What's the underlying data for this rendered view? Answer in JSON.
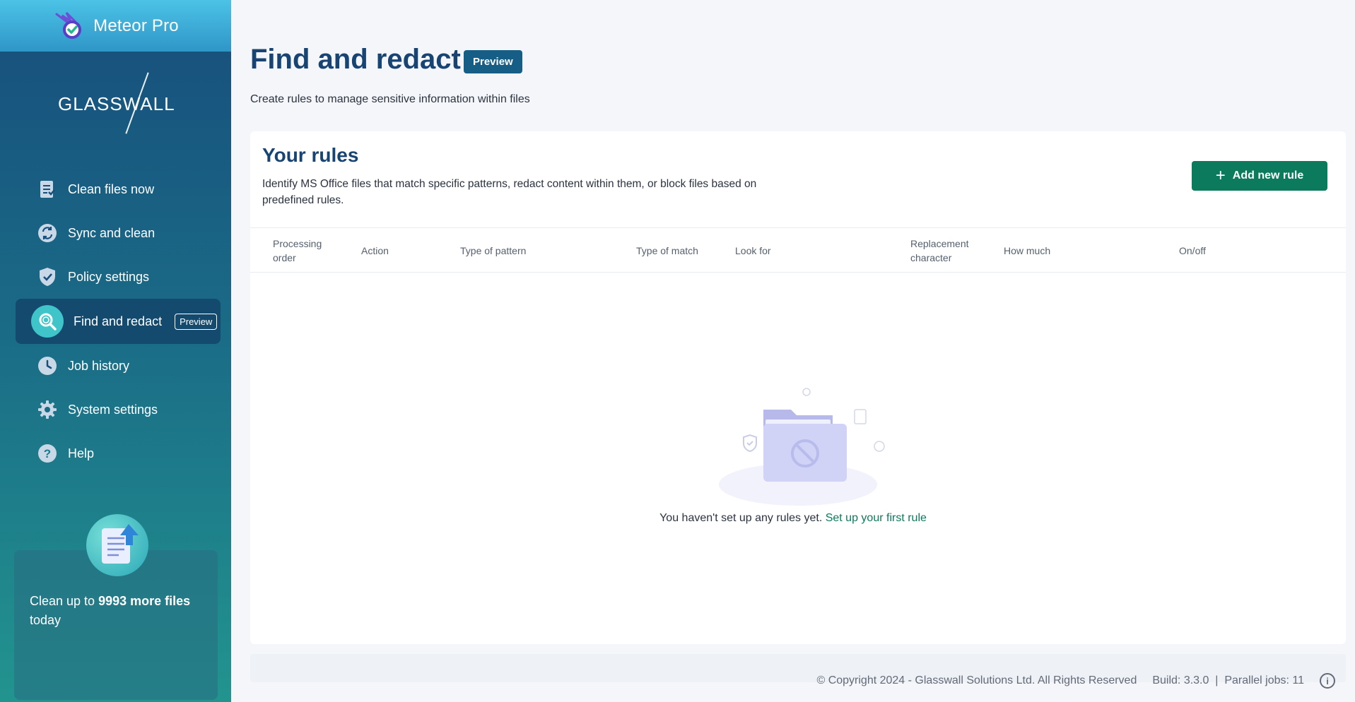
{
  "app": {
    "title": "Meteor Pro",
    "brand": "GLASSWALL"
  },
  "sidebar": {
    "items": [
      {
        "label": "Clean files now",
        "icon": "clean-files-icon"
      },
      {
        "label": "Sync and clean",
        "icon": "sync-icon"
      },
      {
        "label": "Policy settings",
        "icon": "shield-icon"
      },
      {
        "label": "Find and redact",
        "icon": "search-icon",
        "badge": "Preview",
        "active": true
      },
      {
        "label": "Job history",
        "icon": "clock-icon"
      },
      {
        "label": "System settings",
        "icon": "gear-icon"
      },
      {
        "label": "Help",
        "icon": "help-icon"
      }
    ],
    "promo": {
      "prefix": "Clean up to ",
      "highlight": "9993 more files",
      "suffix": " today"
    }
  },
  "page": {
    "title": "Find and redact",
    "badge": "Preview",
    "subtitle": "Create rules to manage sensitive information within files"
  },
  "rules": {
    "title": "Your rules",
    "description": "Identify MS Office files that match specific patterns, redact content within them, or block files based on predefined rules.",
    "add_button": "Add new rule",
    "columns": [
      "Processing order",
      "Action",
      "Type of pattern",
      "Type of match",
      "Look for",
      "Replacement character",
      "How much",
      "On/off"
    ],
    "empty_message": "You haven't set up any rules yet.",
    "empty_link": "Set up your first rule"
  },
  "footer": {
    "copyright": "© Copyright 2024 - Glasswall Solutions Ltd. All Rights Reserved",
    "build": "Build: 3.3.0",
    "separator": "|",
    "parallel_jobs": "Parallel jobs: 11"
  },
  "colors": {
    "accent": "#0c7a5c",
    "title": "#174472",
    "sidebar_top": "#174e7c",
    "sidebar_bottom": "#22948f"
  }
}
